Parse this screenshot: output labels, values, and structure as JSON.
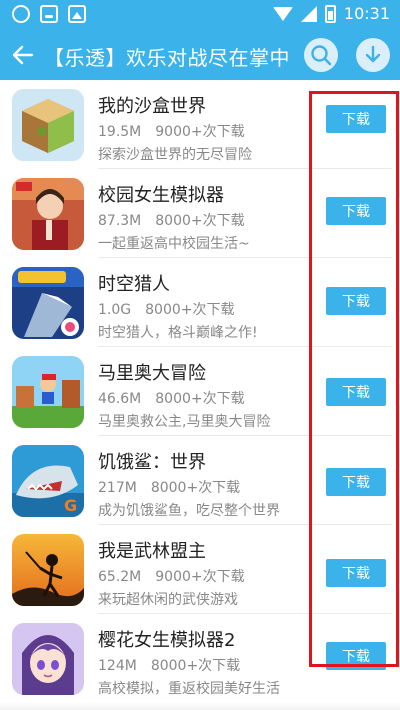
{
  "status_bar": {
    "time": "10:31"
  },
  "header": {
    "title": "【乐透】欢乐对战尽在掌中"
  },
  "apps": [
    {
      "name": "我的沙盒世界",
      "size": "19.5M",
      "downloads": "9000+次下载",
      "desc": "探索沙盒世界的无尽冒险",
      "button": "下载"
    },
    {
      "name": "校园女生模拟器",
      "size": "87.3M",
      "downloads": "8000+次下载",
      "desc": "一起重返高中校园生活~",
      "button": "下载"
    },
    {
      "name": "时空猎人",
      "size": "1.0G",
      "downloads": "8000+次下载",
      "desc": "时空猎人，格斗巅峰之作!",
      "button": "下载"
    },
    {
      "name": "马里奥大冒险",
      "size": "46.6M",
      "downloads": "8000+次下载",
      "desc": "马里奥救公主,马里奥大冒险",
      "button": "下载"
    },
    {
      "name": "饥饿鲨：世界",
      "size": "217M",
      "downloads": "8000+次下载",
      "desc": "成为饥饿鲨鱼，吃尽整个世界",
      "button": "下载"
    },
    {
      "name": "我是武林盟主",
      "size": "65.2M",
      "downloads": "9000+次下载",
      "desc": "来玩超休闲的武侠游戏",
      "button": "下载"
    },
    {
      "name": "樱花女生模拟器2",
      "size": "124M",
      "downloads": "8000+次下载",
      "desc": "高校模拟，重返校园美好生活",
      "button": "下载"
    }
  ],
  "colors": {
    "accent": "#3cb2ea",
    "highlight": "#e2141b"
  }
}
